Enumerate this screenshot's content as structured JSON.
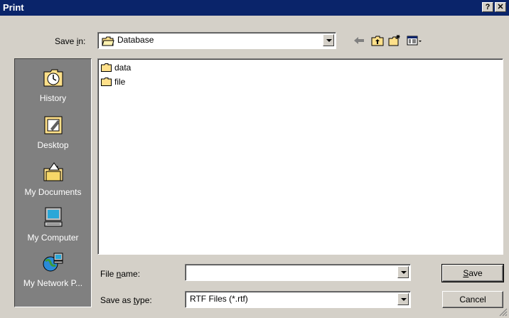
{
  "window": {
    "title": "Print",
    "help_label": "?",
    "close_label": "✕"
  },
  "save_in": {
    "label_pre": "Save ",
    "label_key": "i",
    "label_post": "n:",
    "value": "Database",
    "icon": "folder-open-icon"
  },
  "toolbar": {
    "icons": [
      "back-arrow-icon",
      "up-folder-icon",
      "new-folder-icon",
      "view-menu-icon"
    ]
  },
  "places": [
    {
      "label": "History",
      "icon": "history-icon"
    },
    {
      "label": "Desktop",
      "icon": "desktop-icon"
    },
    {
      "label": "My Documents",
      "icon": "my-documents-icon"
    },
    {
      "label": "My Computer",
      "icon": "my-computer-icon"
    },
    {
      "label": "My Network P...",
      "icon": "my-network-icon"
    }
  ],
  "files": [
    {
      "name": "data",
      "icon": "folder-icon"
    },
    {
      "name": "file",
      "icon": "folder-icon"
    }
  ],
  "file_name": {
    "label_pre": "File ",
    "label_key": "n",
    "label_post": "ame:",
    "value": ""
  },
  "save_as_type": {
    "label_pre": "Save as ",
    "label_key": "t",
    "label_post": "ype:",
    "value": "RTF Files (*.rtf)"
  },
  "buttons": {
    "save_key": "S",
    "save_rest": "ave",
    "cancel": "Cancel"
  },
  "colors": {
    "titlebar": "#0a246a",
    "face": "#d4d0c8",
    "places_bg": "#808080"
  }
}
